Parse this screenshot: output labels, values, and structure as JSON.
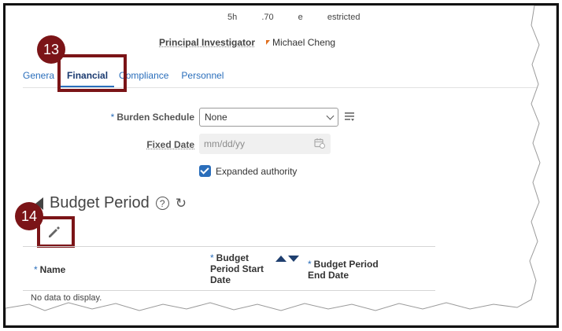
{
  "top_truncated": {
    "items": [
      "5h",
      ".70",
      "e",
      "estricted"
    ]
  },
  "principal_investigator": {
    "label": "Principal Investigator",
    "value": "Michael Cheng"
  },
  "tabs": [
    {
      "label": "Genera",
      "active": false
    },
    {
      "label": "Financial",
      "active": true
    },
    {
      "label": "Compliance",
      "active": false
    },
    {
      "label": "Personnel",
      "active": false
    }
  ],
  "callouts": {
    "step_13": "13",
    "step_14": "14",
    "color": "#7b1417"
  },
  "form": {
    "burden_schedule_label": "Burden Schedule",
    "burden_schedule_value": "None",
    "fixed_date_label": "Fixed Date",
    "fixed_date_placeholder": "mm/dd/yy",
    "expanded_authority_label": "Expanded authority",
    "expanded_authority_checked": true
  },
  "budget_period": {
    "title": "Budget Period",
    "help_glyph": "?",
    "refresh_glyph": "↻",
    "columns": {
      "name": "Name",
      "start_line1": "Budget",
      "start_line2": "Period Start",
      "start_line3": "Date",
      "end_line1": "Budget Period",
      "end_line2": "End Date"
    },
    "empty_text": "No data to display."
  },
  "icons": {
    "pencil": "edit-icon",
    "calendar": "calendar-icon",
    "list": "list-icon"
  },
  "colors": {
    "accent": "#2a6ebb",
    "callout": "#7b1417"
  }
}
